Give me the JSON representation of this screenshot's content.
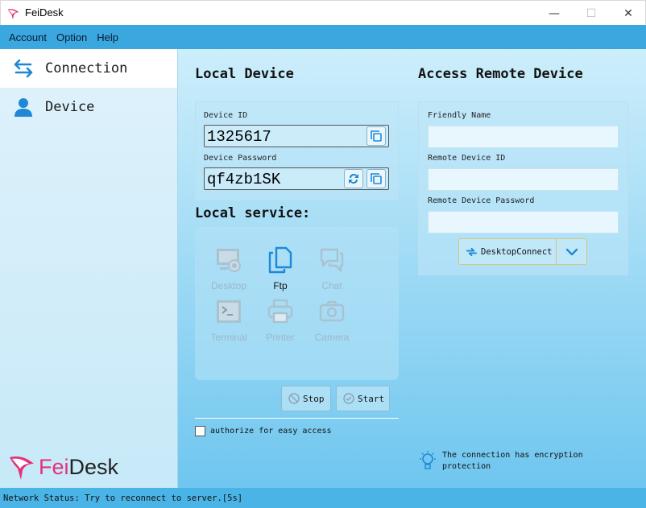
{
  "window": {
    "title": "FeiDesk",
    "minimize_glyph": "—",
    "maximize_glyph": "☐",
    "close_glyph": "✕"
  },
  "menu": [
    {
      "label": "Account"
    },
    {
      "label": "Option"
    },
    {
      "label": "Help"
    }
  ],
  "sidebar": {
    "items": [
      {
        "label": "Connection",
        "icon": "swap-arrows-icon",
        "active": true
      },
      {
        "label": "Device",
        "icon": "user-icon",
        "active": false
      }
    ],
    "brand": {
      "part1": "Fei",
      "part2": "Desk"
    }
  },
  "local_device": {
    "title": "Local Device",
    "device_id_label": "Device ID",
    "device_id": "1325617",
    "password_label": "Device Password",
    "password": "qf4zb1SK"
  },
  "local_service": {
    "title": "Local service:",
    "items": [
      {
        "label": "Desktop",
        "icon": "desktop-icon",
        "enabled": false
      },
      {
        "label": "Ftp",
        "icon": "copy-files-icon",
        "enabled": true
      },
      {
        "label": "Chat",
        "icon": "chat-icon",
        "enabled": false
      },
      {
        "label": "Terminal",
        "icon": "terminal-icon",
        "enabled": false
      },
      {
        "label": "Printer",
        "icon": "printer-icon",
        "enabled": false
      },
      {
        "label": "Camera",
        "icon": "camera-icon",
        "enabled": false
      }
    ],
    "stop_label": "Stop",
    "start_label": "Start",
    "authorize_label": "authorize for easy access",
    "authorize_checked": false
  },
  "remote": {
    "title": "Access Remote Device",
    "friendly_name_label": "Friendly Name",
    "friendly_name_value": "",
    "remote_id_label": "Remote Device ID",
    "remote_id_value": "",
    "remote_password_label": "Remote Device Password",
    "remote_password_value": "",
    "connect_label": "DesktopConnect",
    "encryption_note": "The connection has encryption protection"
  },
  "status": {
    "text": "Network Status: Try to reconnect to server.[5s]"
  },
  "colors": {
    "menubar": "#3aa7df",
    "accent_blue": "#1e88d6",
    "brand_pink": "#e5307a",
    "disabled_icon": "#a9c2d0"
  }
}
